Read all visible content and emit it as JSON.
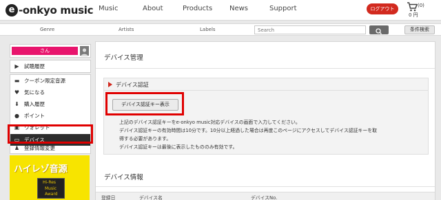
{
  "header": {
    "logo_mark": "e",
    "logo_text": "-onkyo music",
    "nav": [
      "Music",
      "About",
      "Products",
      "News",
      "Support"
    ],
    "logout_label": "ログアウト",
    "cart_count": "(0)",
    "cart_total": "0 円"
  },
  "searchbar": {
    "genre_label": "Genre",
    "artists_label": "Artists",
    "labels_label": "Labels",
    "search_placeholder": "Search",
    "advanced_label": "条件検索"
  },
  "sidebar": {
    "user_name": "さん",
    "items": [
      {
        "label": "試聴履歴",
        "icon": "play-triangle-icon"
      },
      {
        "label": "クーポン限定音源",
        "icon": "coupon-icon"
      },
      {
        "label": "気になる",
        "icon": "heart-icon"
      },
      {
        "label": "購入履歴",
        "icon": "download-icon"
      },
      {
        "label": "ポイント",
        "icon": "point-coin-icon"
      },
      {
        "label": "ウォレット",
        "icon": "wallet-icon"
      },
      {
        "label": "デバイス",
        "icon": "device-icon"
      },
      {
        "label": "登録情報変更",
        "icon": "person-icon"
      }
    ],
    "active_item": "デバイス",
    "banner": {
      "title": "ハイレゾ音源",
      "badge_line1": "Hi-Res",
      "badge_line2": "Music",
      "badge_line3": "Award"
    }
  },
  "main": {
    "page_title": "デバイス管理",
    "auth_section_title": "デバイス認証",
    "show_key_button": "デバイス認証キー表示",
    "description": [
      "上記のデバイス認証キーをe-onkyo music対応デバイスの画面で入力してください。",
      "デバイス認証キーの有効時間は10分です。10分以上経過した場合は再度このページにアクセスしてデバイス認証キーを取",
      "得する必要があります。",
      "デバイス認証キーは最後に表示したもののみ有効です。"
    ],
    "device_info_title": "デバイス情報",
    "table_columns": [
      "登録日",
      "デバイス名",
      "デバイスNo."
    ]
  },
  "colors": {
    "accent_red": "#d22a1f",
    "user_pink": "#e8156d",
    "banner_yellow": "#f7e400",
    "active_item_bg": "#2d2d2d",
    "highlight_red": "#e00000"
  }
}
